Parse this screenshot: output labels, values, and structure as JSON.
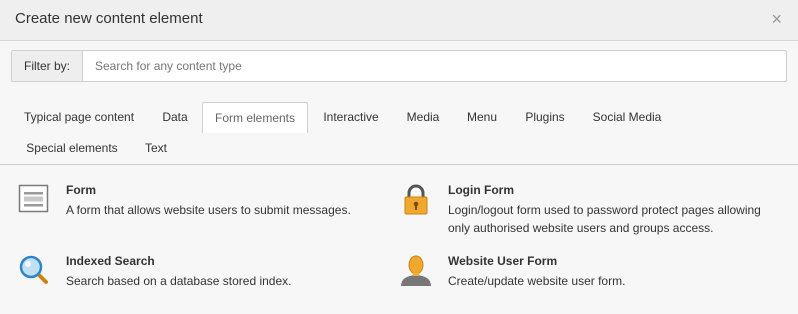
{
  "dialog": {
    "title": "Create new content element",
    "close_glyph": "×"
  },
  "filter": {
    "label": "Filter by:",
    "value": "",
    "placeholder": "Search for any content type"
  },
  "tabs": [
    {
      "label": "Typical page content",
      "active": false
    },
    {
      "label": "Data",
      "active": false
    },
    {
      "label": "Form elements",
      "active": true
    },
    {
      "label": "Interactive",
      "active": false
    },
    {
      "label": "Media",
      "active": false
    },
    {
      "label": "Menu",
      "active": false
    },
    {
      "label": "Plugins",
      "active": false
    },
    {
      "label": "Social Media",
      "active": false
    },
    {
      "label": "Special elements",
      "active": false
    },
    {
      "label": "Text",
      "active": false
    }
  ],
  "elements": [
    {
      "icon": "form-icon",
      "name": "Form",
      "description": "A form that allows website users to submit messages."
    },
    {
      "icon": "lock-icon",
      "name": "Login Form",
      "description": "Login/logout form used to password protect pages allowing only authorised website users and groups access."
    },
    {
      "icon": "search-icon",
      "name": "Indexed Search",
      "description": "Search based on a database stored index."
    },
    {
      "icon": "user-icon",
      "name": "Website User Form",
      "description": "Create/update website user form."
    }
  ],
  "colors": {
    "accent_lock": "#f0a830",
    "accent_search": "#2e86c9",
    "accent_user": "#f0a830"
  }
}
